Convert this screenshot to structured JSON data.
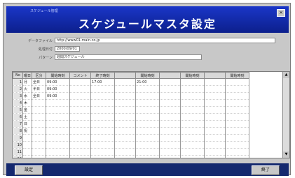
{
  "window": {
    "caption": "スケジュール管理",
    "title": "スケジュールマスタ設定",
    "close_glyph": "×"
  },
  "form": {
    "fields": [
      {
        "label": "データファイル",
        "value": "http://www01.main.co.jp"
      },
      {
        "label": "処理日付",
        "value": "2000/09/01"
      },
      {
        "label": "パターン",
        "value": "週間スケジュール"
      }
    ]
  },
  "table": {
    "headers": [
      "No",
      "曜日",
      "区分",
      "開始時刻",
      "コメント",
      "終了時刻",
      "",
      "開始時刻",
      "",
      "開始時刻",
      "",
      "開始時刻"
    ],
    "rows": [
      [
        "1",
        "月",
        "全日",
        "09:00",
        "",
        "17:00",
        "",
        "21:00",
        "",
        "",
        "",
        ""
      ],
      [
        "2",
        "火",
        "半日",
        "09:00",
        "",
        "",
        "",
        "",
        "",
        "",
        "",
        ""
      ],
      [
        "3",
        "水",
        "全日",
        "09:00",
        "",
        "",
        "",
        "",
        "",
        "",
        "",
        ""
      ],
      [
        "4",
        "木",
        "",
        "",
        "",
        "",
        "",
        "",
        "",
        "",
        "",
        ""
      ],
      [
        "5",
        "金",
        "",
        "",
        "",
        "",
        "",
        "",
        "",
        "",
        "",
        ""
      ],
      [
        "6",
        "土",
        "",
        "",
        "",
        "",
        "",
        "",
        "",
        "",
        "",
        ""
      ],
      [
        "7",
        "日",
        "",
        "",
        "",
        "",
        "",
        "",
        "",
        "",
        "",
        ""
      ],
      [
        "8",
        "祝",
        "",
        "",
        "",
        "",
        "",
        "",
        "",
        "",
        "",
        ""
      ],
      [
        "9",
        "",
        "",
        "",
        "",
        "",
        "",
        "",
        "",
        "",
        "",
        ""
      ],
      [
        "10",
        "",
        "",
        "",
        "",
        "",
        "",
        "",
        "",
        "",
        "",
        ""
      ],
      [
        "11",
        "",
        "",
        "",
        "",
        "",
        "",
        "",
        "",
        "",
        "",
        ""
      ],
      [
        "12",
        "",
        "",
        "",
        "",
        "",
        "",
        "",
        "",
        "",
        "",
        ""
      ]
    ]
  },
  "footer": {
    "left_button": "設定",
    "right_button": "終了"
  }
}
